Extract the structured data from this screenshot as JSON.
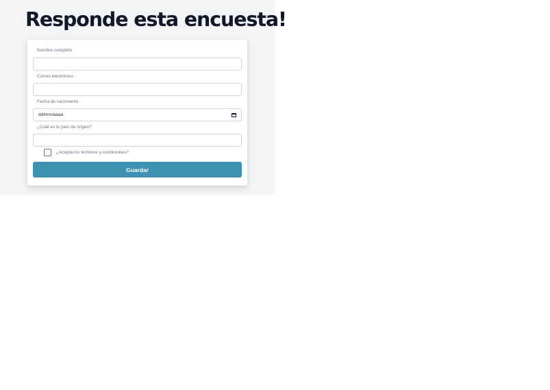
{
  "page": {
    "title": "Responde esta encuesta!"
  },
  "form": {
    "fields": [
      {
        "label": "Nombre completo",
        "value": "",
        "type": "text"
      },
      {
        "label": "Correo electrónico",
        "value": "",
        "type": "email"
      },
      {
        "label": "Fecha de nacimiento",
        "placeholder": "dd/mm/aaaa",
        "type": "date",
        "icon": "calendar-icon"
      },
      {
        "label": "¿Cuál es tu país de origen?",
        "value": "",
        "type": "text"
      }
    ],
    "terms": {
      "label": "¿Acepta los términos y condiciones?",
      "checked": false
    },
    "submit_label": "Guardar"
  },
  "colors": {
    "page_background": "#f3f4f6",
    "title": "#111827",
    "button": "#3e91b0",
    "button_text": "#ffffff",
    "label": "#6b7280",
    "input_border": "#d1d5db"
  }
}
